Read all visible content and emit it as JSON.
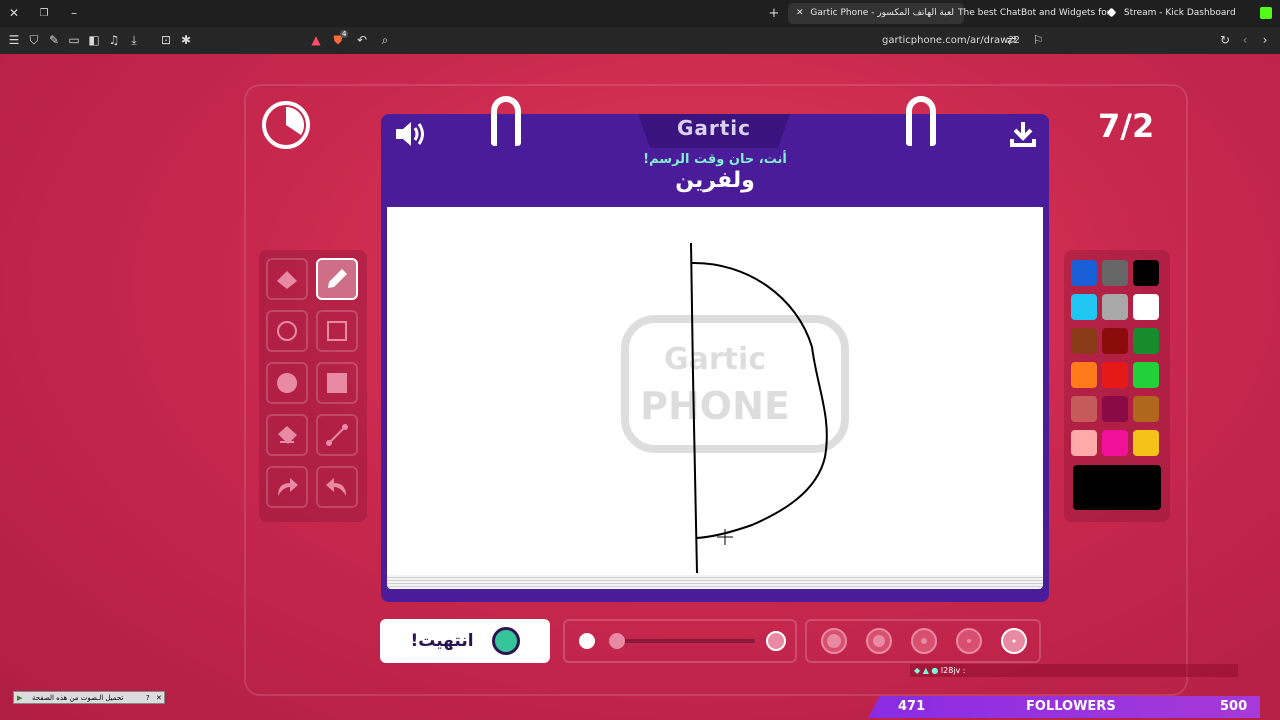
{
  "browser": {
    "tabs": [
      {
        "label": "Gartic Phone - لعبة الهاتف المكسور",
        "active": true
      },
      {
        "label": "The best ChatBot and Widgets for Kick",
        "active": false
      },
      {
        "label": "Stream - Kick Dashboard",
        "active": false
      }
    ],
    "url": "garticphone.com/ar/draw?2",
    "shield_badge": "4"
  },
  "game": {
    "logo": "Gartic",
    "watermark_line1": "Gartic",
    "watermark_line2": "PHONE",
    "prompt": "أنت، حان وقت الرسم!",
    "word": "ولفرين",
    "round_counter": "7/2",
    "done_label": "انتهيت!",
    "current_color": "#000000"
  },
  "tools": [
    {
      "name": "eraser-tool",
      "icon": "eraser-icon"
    },
    {
      "name": "pencil-tool",
      "icon": "pencil-icon",
      "active": true
    },
    {
      "name": "circle-outline-tool",
      "icon": "circle-outline-icon"
    },
    {
      "name": "square-outline-tool",
      "icon": "square-outline-icon"
    },
    {
      "name": "circle-filled-tool",
      "icon": "circle-filled-icon"
    },
    {
      "name": "square-filled-tool",
      "icon": "square-filled-icon"
    },
    {
      "name": "fill-tool",
      "icon": "paint-bucket-icon"
    },
    {
      "name": "line-tool",
      "icon": "line-icon"
    },
    {
      "name": "redo-tool",
      "icon": "redo-icon"
    },
    {
      "name": "undo-tool",
      "icon": "undo-icon"
    }
  ],
  "palette": [
    "#1a5fd6",
    "#666666",
    "#000000",
    "#20c6f2",
    "#a8a8a8",
    "#ffffff",
    "#8a3a16",
    "#8c0c0c",
    "#168c2e",
    "#ff7a1a",
    "#e61919",
    "#22d13a",
    "#c45a5a",
    "#8a0a45",
    "#b0661c",
    "#ffaaaa",
    "#f0109a",
    "#f5c21a"
  ],
  "overlay": {
    "chat_text": "l28jv :",
    "followers_current": "471",
    "followers_label": "FOLLOWERS",
    "followers_goal": "500",
    "sound_notice": "تحميل الـصوت من هذه الصفحة"
  }
}
